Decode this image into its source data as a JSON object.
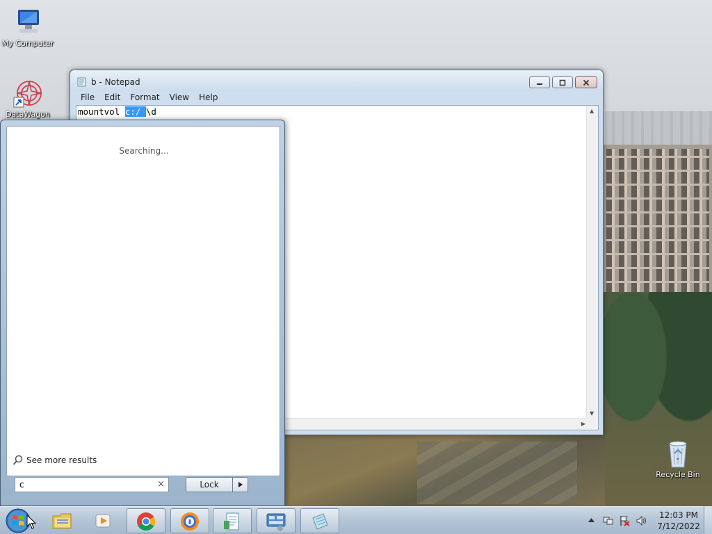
{
  "desktop": {
    "icons": [
      {
        "label": "My Computer",
        "icon": "computer-icon"
      },
      {
        "label": "DataWagon",
        "icon": "datawagon-icon"
      },
      {
        "label": "Recycle Bin",
        "icon": "recycle-bin-icon"
      }
    ]
  },
  "notepad": {
    "title": "b - Notepad",
    "menu": [
      "File",
      "Edit",
      "Format",
      "View",
      "Help"
    ],
    "text_before": "mountvol ",
    "text_selected": "c:/ ",
    "text_after": "\\d"
  },
  "start_menu": {
    "status": "Searching...",
    "see_more": "See more results",
    "search_value": "c",
    "lock_label": "Lock"
  },
  "taskbar": {
    "apps": [
      {
        "name": "windows-explorer",
        "icon": "folder-icon"
      },
      {
        "name": "media-player",
        "icon": "media-player-icon"
      },
      {
        "name": "chrome",
        "icon": "chrome-icon"
      },
      {
        "name": "avast-browser",
        "icon": "browser-icon"
      },
      {
        "name": "wordpad",
        "icon": "document-icon"
      },
      {
        "name": "control-panel",
        "icon": "control-panel-icon"
      },
      {
        "name": "notepad",
        "icon": "notepad-icon"
      }
    ],
    "clock_time": "12:03 PM",
    "clock_date": "7/12/2022"
  },
  "colors": {
    "selection": "#3399ff",
    "taskbar": "#b3c4d6",
    "window_frame": "#cfdeee"
  }
}
